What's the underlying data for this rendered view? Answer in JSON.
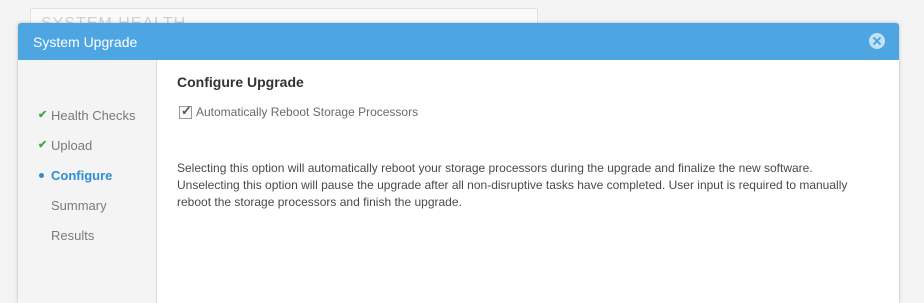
{
  "background": {
    "card_title": "SYSTEM HEALTH"
  },
  "dialog": {
    "title": "System Upgrade",
    "close_icon": "close-circle-icon",
    "accent_color": "#4da6e2",
    "steps": [
      {
        "label": "Health Checks",
        "state": "complete"
      },
      {
        "label": "Upload",
        "state": "complete"
      },
      {
        "label": "Configure",
        "state": "active"
      },
      {
        "label": "Summary",
        "state": "pending"
      },
      {
        "label": "Results",
        "state": "pending"
      }
    ],
    "content": {
      "title": "Configure Upgrade",
      "checkbox": {
        "label": "Automatically Reboot Storage Processors",
        "checked": true
      },
      "description_lines": [
        "Selecting this option will automatically reboot your storage processors during the upgrade and finalize the new software.",
        "Unselecting this option will pause the upgrade after all non-disruptive tasks have completed. User input is required to manually",
        "reboot the storage processors and finish the upgrade."
      ]
    }
  }
}
